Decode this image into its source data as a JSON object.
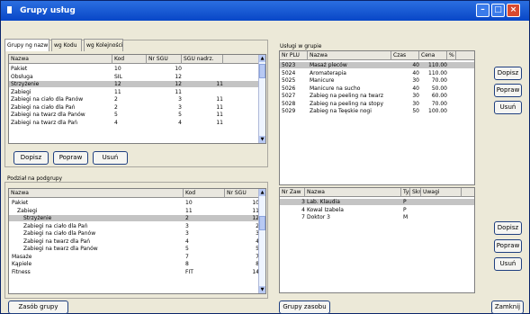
{
  "window": {
    "title": "Grupy usług"
  },
  "top_left": {
    "tabs": [
      "Grupy ng nazw",
      "wg Kodu",
      "wg Kolejności"
    ],
    "headers": [
      "Nazwa",
      "Kod",
      "Nr SGU",
      "SGU nadrz."
    ],
    "rows": [
      [
        "Pakiet",
        "10",
        "10",
        ""
      ],
      [
        "Obsługa",
        "SIL",
        "12",
        ""
      ],
      [
        "Strzyżenie",
        "12",
        "12",
        "11"
      ],
      [
        "Zabiegi",
        "11",
        "11",
        ""
      ],
      [
        "Zabiegi na ciało dla Panów",
        "2",
        "3",
        "11"
      ],
      [
        "Zabiegi na ciało dla Pań",
        "2",
        "3",
        "11"
      ],
      [
        "Zabiegi na twarz dla Panów",
        "5",
        "5",
        "11"
      ],
      [
        "Zabiegi na twarz dla Pań",
        "4",
        "4",
        "11"
      ]
    ],
    "buttons": [
      "Dopisz",
      "Popraw",
      "Usuń"
    ]
  },
  "bottom_left": {
    "title": "Podział na podgrupy",
    "headers": [
      "Nazwa",
      "Kod",
      "Nr SGU"
    ],
    "rows": [
      [
        "Pakiet",
        "10",
        "10"
      ],
      [
        "Zabiegi",
        "11",
        "11"
      ],
      [
        "Strzyżenie",
        "2",
        "12"
      ],
      [
        "Zabiegi na ciało dla Pań",
        "3",
        "2"
      ],
      [
        "Zabiegi na ciało dla Panów",
        "3",
        "3"
      ],
      [
        "Zabiegi na twarz dla Pań",
        "4",
        "4"
      ],
      [
        "Zabiegi na twarz dla Panów",
        "5",
        "5"
      ],
      [
        "Masaże",
        "7",
        "7"
      ],
      [
        "Kąpiele",
        "8",
        "8"
      ],
      [
        "Fitness",
        "FIT",
        "14"
      ]
    ],
    "button": "Zasób grupy"
  },
  "top_right": {
    "title": "Usługi w grupie",
    "headers": [
      "Nr PLU",
      "Nazwa",
      "Czas",
      "Cena",
      "%"
    ],
    "rows": [
      [
        "5023",
        "Masaż pleców",
        "40",
        "110.00",
        ""
      ],
      [
        "5024",
        "Aromaterapia",
        "40",
        "110.00",
        ""
      ],
      [
        "5025",
        "Manicure",
        "30",
        "70.00",
        ""
      ],
      [
        "5026",
        "Manicure na sucho",
        "40",
        "50.00",
        ""
      ],
      [
        "5027",
        "Zabieg na peeling na twarz",
        "30",
        "60.00",
        ""
      ],
      [
        "5028",
        "Zabieg na peeling na stopy",
        "30",
        "70.00",
        ""
      ],
      [
        "5029",
        "Zabieg na Teęskie nogi",
        "50",
        "100.00",
        ""
      ]
    ],
    "buttons": [
      "Dopisz",
      "Popraw",
      "Usuń"
    ]
  },
  "bottom_right": {
    "headers": [
      "Nr Zaw",
      "Nazwa",
      "Typ",
      "Skr",
      "Uwagi"
    ],
    "rows": [
      [
        "3",
        "Lab. Klaudia",
        "P",
        "",
        ""
      ],
      [
        "4",
        "Kowal Izabela",
        "P",
        "",
        ""
      ],
      [
        "7",
        "Doktor 3",
        "M",
        "",
        ""
      ]
    ],
    "buttons": [
      "Dopisz",
      "Popraw",
      "Usuń"
    ],
    "bottom_button": "Grupy zasobu"
  },
  "close_button": "Zamknij"
}
